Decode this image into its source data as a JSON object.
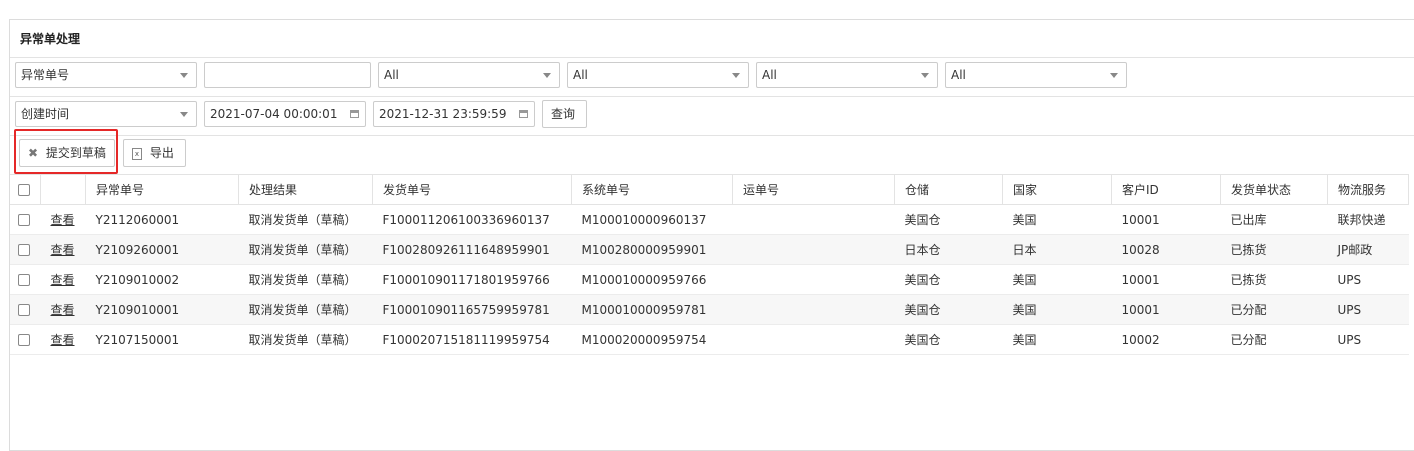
{
  "panel": {
    "title": "异常单处理"
  },
  "filters": {
    "row1": {
      "field_select": "异常单号",
      "field_value": "",
      "selects": [
        "All",
        "All",
        "All",
        "All"
      ]
    },
    "row2": {
      "field_select": "创建时间",
      "date_from": "2021-07-04 00:00:01",
      "date_to": "2021-12-31 23:59:59",
      "query_label": "查询"
    }
  },
  "toolbar": {
    "submit_draft_label": "提交到草稿",
    "export_label": "导出"
  },
  "table": {
    "headers": [
      "异常单号",
      "处理结果",
      "发货单号",
      "系统单号",
      "运单号",
      "仓储",
      "国家",
      "客户ID",
      "发货单状态",
      "物流服务"
    ],
    "view_label": "查看",
    "rows": [
      [
        "Y2112060001",
        "取消发货单（草稿）",
        "F100011206100336960137",
        "M100010000960137",
        "",
        "美国仓",
        "美国",
        "10001",
        "已出库",
        "联邦快递"
      ],
      [
        "Y2109260001",
        "取消发货单（草稿）",
        "F100280926111648959901",
        "M100280000959901",
        "",
        "日本仓",
        "日本",
        "10028",
        "已拣货",
        "JP邮政"
      ],
      [
        "Y2109010002",
        "取消发货单（草稿）",
        "F100010901171801959766",
        "M100010000959766",
        "",
        "美国仓",
        "美国",
        "10001",
        "已拣货",
        "UPS"
      ],
      [
        "Y2109010001",
        "取消发货单（草稿）",
        "F100010901165759959781",
        "M100010000959781",
        "",
        "美国仓",
        "美国",
        "10001",
        "已分配",
        "UPS"
      ],
      [
        "Y2107150001",
        "取消发货单（草稿）",
        "F100020715181119959754",
        "M100020000959754",
        "",
        "美国仓",
        "美国",
        "10002",
        "已分配",
        "UPS"
      ]
    ]
  }
}
